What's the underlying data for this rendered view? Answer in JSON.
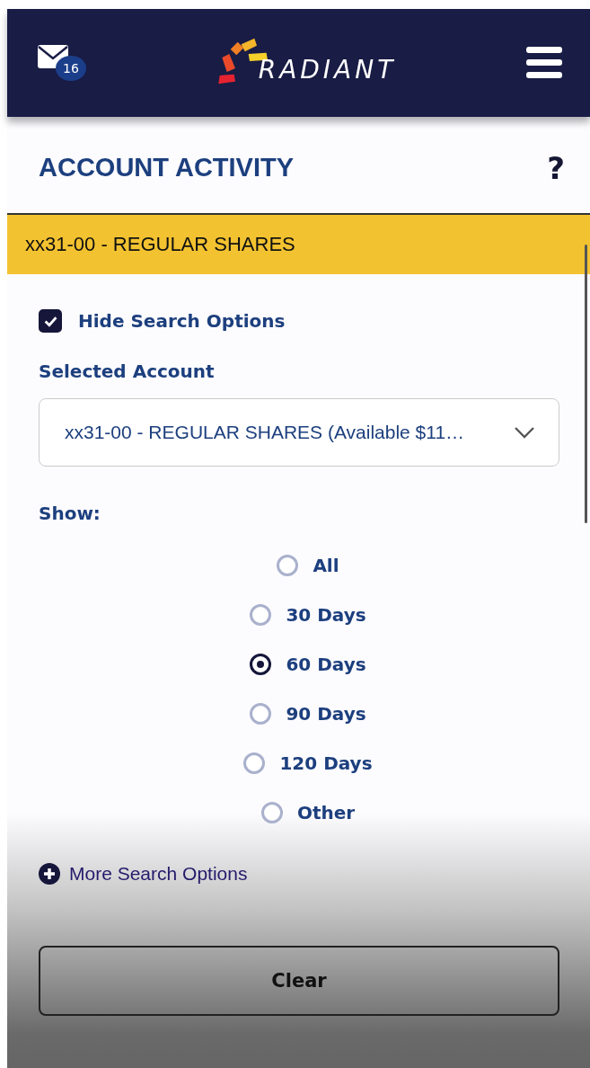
{
  "header": {
    "mail_badge": "16",
    "logo_text": "RADIANT"
  },
  "page_title": "ACCOUNT ACTIVITY",
  "help": "?",
  "account_banner": "xx31-00 - REGULAR SHARES",
  "hide_search_options": {
    "label": "Hide Search Options",
    "checked": true
  },
  "selected_account": {
    "label": "Selected Account",
    "value": "xx31-00 - REGULAR SHARES (Available $11…"
  },
  "show": {
    "label": "Show:",
    "options": [
      {
        "label": "All",
        "selected": false
      },
      {
        "label": "30 Days",
        "selected": false
      },
      {
        "label": "60 Days",
        "selected": true
      },
      {
        "label": "90 Days",
        "selected": false
      },
      {
        "label": "120 Days",
        "selected": false
      },
      {
        "label": "Other",
        "selected": false
      }
    ]
  },
  "more_search_options": "More Search Options",
  "buttons": [
    "Clear"
  ]
}
